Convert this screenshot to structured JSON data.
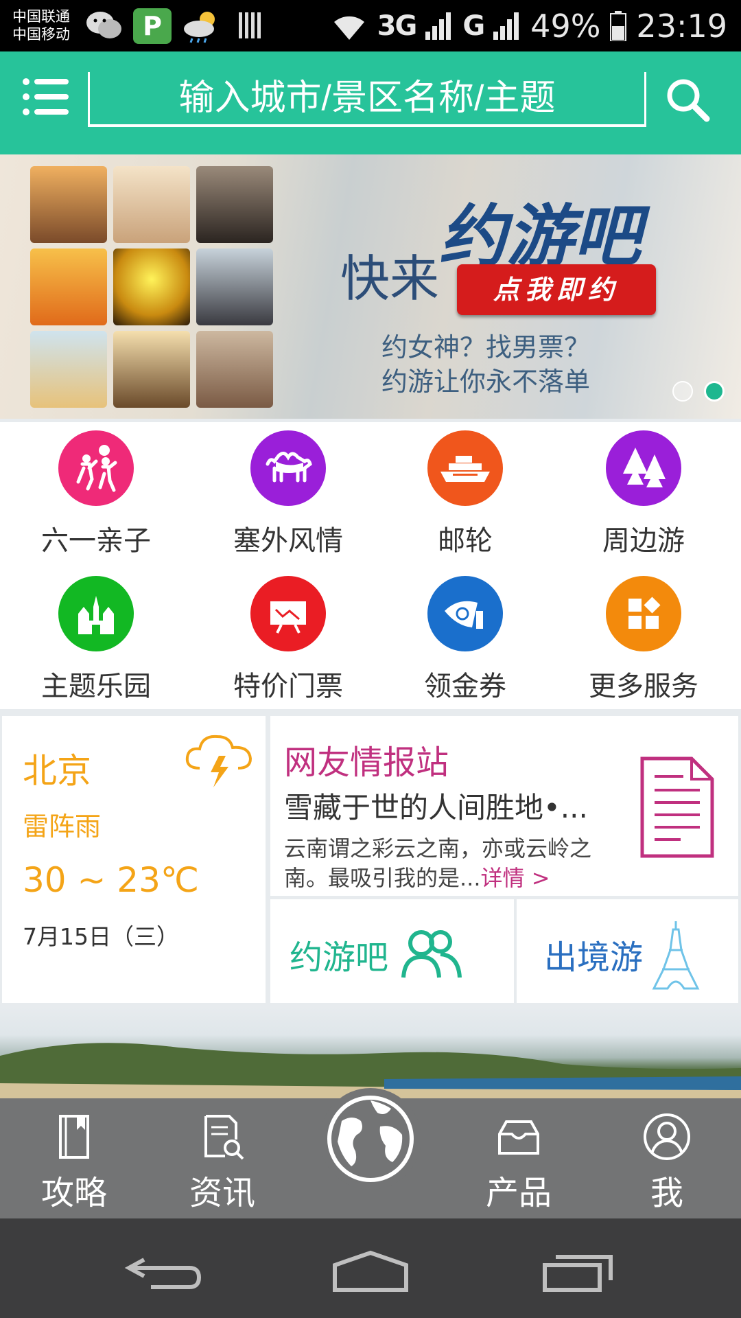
{
  "status_bar": {
    "carrier1": "中国联通",
    "carrier2": "中国移动",
    "network1": "3G",
    "network2": "G",
    "battery": "49%",
    "time": "23:19"
  },
  "header": {
    "search_placeholder": "输入城市/景区名称/主题",
    "accent_color": "#27c39a"
  },
  "banner": {
    "headline_small": "快来",
    "headline_big": "约游吧",
    "button_label": "点我即约",
    "line1": "约女神？找男票？",
    "line2": "约游让你永不落单",
    "active_slide": 2,
    "slide_count": 2
  },
  "categories": [
    {
      "label": "六一亲子",
      "icon": "kids-icon",
      "color": "#ef2a78"
    },
    {
      "label": "塞外风情",
      "icon": "camel-icon",
      "color": "#9a1fd9"
    },
    {
      "label": "邮轮",
      "icon": "cruise-ship-icon",
      "color": "#f0561c"
    },
    {
      "label": "周边游",
      "icon": "trees-icon",
      "color": "#9a1fd9"
    },
    {
      "label": "主题乐园",
      "icon": "castle-icon",
      "color": "#12b823"
    },
    {
      "label": "特价门票",
      "icon": "ticket-board-icon",
      "color": "#ea1d24"
    },
    {
      "label": "领金券",
      "icon": "coupon-icon",
      "color": "#1a6fcc"
    },
    {
      "label": "更多服务",
      "icon": "more-grid-icon",
      "color": "#f38a0c"
    }
  ],
  "weather": {
    "city": "北京",
    "condition": "雷阵雨",
    "temperature": "30 ~ 23℃",
    "date": "7月15日（三）"
  },
  "intel": {
    "title": "网友情报站",
    "headline": "雪藏于世的人间胜地•...",
    "desc": "云南谓之彩云之南，亦或云岭之南。最吸引我的是...",
    "more": "详情 >"
  },
  "quick_links": {
    "yueyou": "约游吧",
    "abroad": "出境游"
  },
  "tabs": [
    {
      "label": "攻略",
      "icon": "guide-book-icon"
    },
    {
      "label": "资讯",
      "icon": "news-search-icon"
    },
    {
      "label": "",
      "icon": "globe-icon"
    },
    {
      "label": "产品",
      "icon": "product-box-icon"
    },
    {
      "label": "我",
      "icon": "user-icon"
    }
  ]
}
